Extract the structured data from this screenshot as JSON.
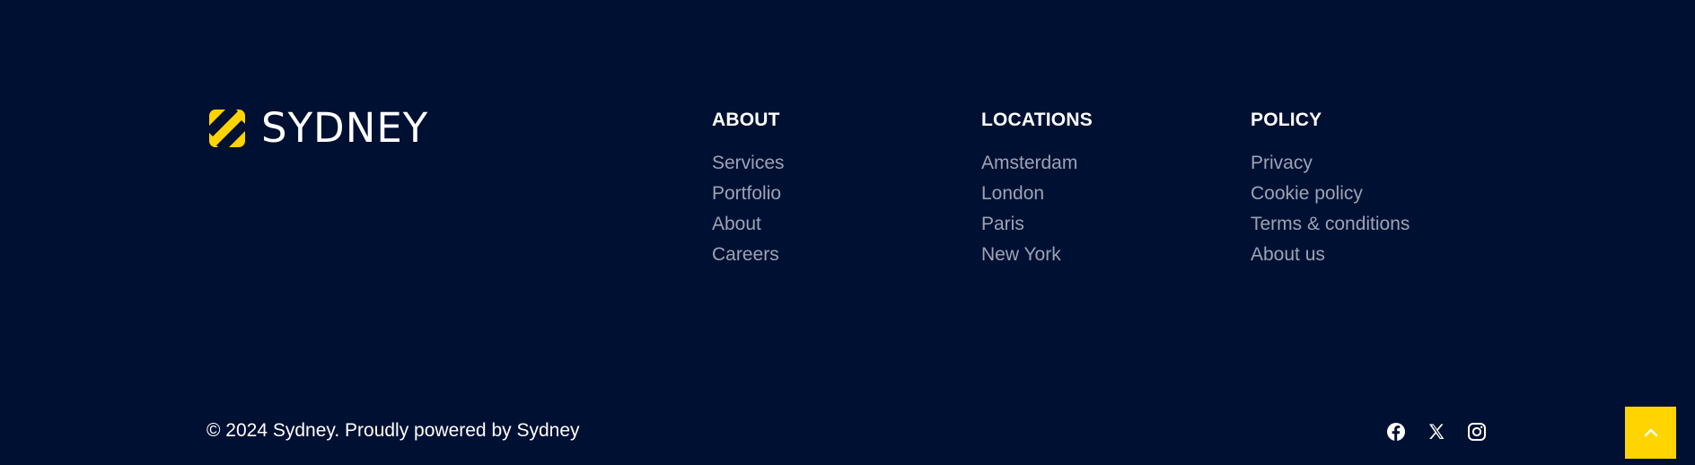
{
  "brand": {
    "name": "SYDNEY",
    "mark_icon": "sydney-s-logo-mark",
    "accent_color": "#ffd400"
  },
  "colors": {
    "background": "#001032",
    "heading": "#ffffff",
    "link": "#9ba3b5"
  },
  "columns": [
    {
      "title": "ABOUT",
      "links": [
        "Services",
        "Portfolio",
        "About",
        "Careers"
      ]
    },
    {
      "title": "LOCATIONS",
      "links": [
        "Amsterdam",
        "London",
        "Paris",
        "New York"
      ]
    },
    {
      "title": "POLICY",
      "links": [
        "Privacy",
        "Cookie policy",
        "Terms & conditions",
        "About us"
      ]
    }
  ],
  "footer": {
    "copyright": "© 2024 Sydney. Proudly powered by Sydney"
  },
  "social": [
    {
      "icon": "facebook-icon"
    },
    {
      "icon": "x-twitter-icon"
    },
    {
      "icon": "instagram-icon"
    }
  ],
  "back_to_top": {
    "icon": "chevron-up-icon"
  }
}
